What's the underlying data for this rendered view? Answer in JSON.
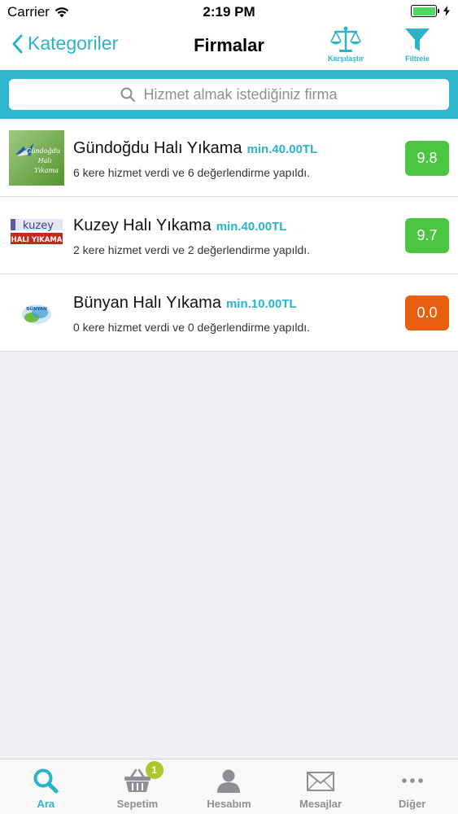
{
  "status_bar": {
    "carrier": "Carrier",
    "time": "2:19 PM"
  },
  "nav": {
    "back_label": "Kategoriler",
    "title": "Firmalar",
    "compare_label": "Karşılaştır",
    "filter_label": "Filtrele"
  },
  "search": {
    "placeholder": "Hizmet almak istediğiniz firma"
  },
  "companies": [
    {
      "name": "Gündoğdu Halı Yıkama",
      "min_price": "min.40.00TL",
      "description": "6 kere hizmet verdi ve 6 değerlendirme yapıldı.",
      "score": "9.8",
      "score_color": "#4cc541",
      "logo_text": [
        "Gündoğdu",
        "Halı",
        "Yıkama"
      ]
    },
    {
      "name": "Kuzey Halı Yıkama",
      "min_price": "min.40.00TL",
      "description": "2 kere hizmet verdi ve 2 değerlendirme yapıldı.",
      "score": "9.7",
      "score_color": "#4cc541",
      "logo_text": [
        "kuzey",
        "HALI YIKAMA"
      ]
    },
    {
      "name": "Bünyan Halı Yıkama",
      "min_price": "min.10.00TL",
      "description": "0 kere hizmet verdi ve 0 değerlendirme yapıldı.",
      "score": "0.0",
      "score_color": "#e8600f",
      "logo_text": [
        "BÜNYAN"
      ]
    }
  ],
  "tabs": [
    {
      "label": "Ara",
      "icon": "search-icon"
    },
    {
      "label": "Sepetim",
      "icon": "basket-icon",
      "badge": "1"
    },
    {
      "label": "Hesabım",
      "icon": "person-icon"
    },
    {
      "label": "Mesajlar",
      "icon": "envelope-icon"
    },
    {
      "label": "Diğer",
      "icon": "more-icon"
    }
  ],
  "colors": {
    "accent": "#2bb3c9",
    "search_band": "#2fb6cc",
    "score_good": "#4cc541",
    "score_bad": "#e8600f",
    "badge": "#a8c82b"
  }
}
